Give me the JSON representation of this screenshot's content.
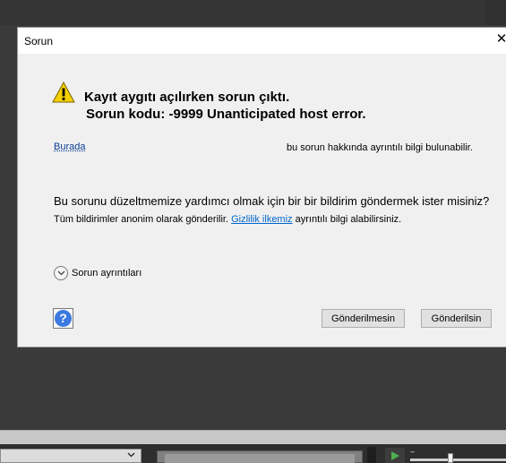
{
  "dialog": {
    "title": "Sorun",
    "close_glyph": "✕",
    "headline_line1": "Kayıt aygıtı açılırken sorun çıktı.",
    "headline_line2": "Sorun kodu: -9999 Unanticipated host error.",
    "link_text": "Burada",
    "link_suffix": "bu sorun hakkında ayrıntılı bilgi bulunabilir.",
    "question": "Bu sorunu düzeltmemize yardımcı olmak için bir bir bildirim göndermek ister misiniz?",
    "privacy_prefix": "Tüm bildirimler anonim olarak gönderilir.",
    "privacy_link": "Gizlilik ilkemiz",
    "privacy_suffix": "ayrıntılı bilgi alabilirsiniz.",
    "details_label": "Sorun ayrıntıları",
    "help_glyph": "?",
    "btn_no": "Gönderilmesin",
    "btn_yes": "Gönderilsin"
  },
  "icons": {
    "warning": "warning-icon",
    "close": "close-icon",
    "chevron": "chevron-down-icon",
    "help": "help-icon",
    "play": "play-icon"
  },
  "bottom": {
    "dash": "–"
  },
  "colors": {
    "accent_link": "#0066cc",
    "warning_yellow": "#f5d000",
    "help_blue": "#3b7ae0",
    "background_dark": "#3a3a3a"
  }
}
